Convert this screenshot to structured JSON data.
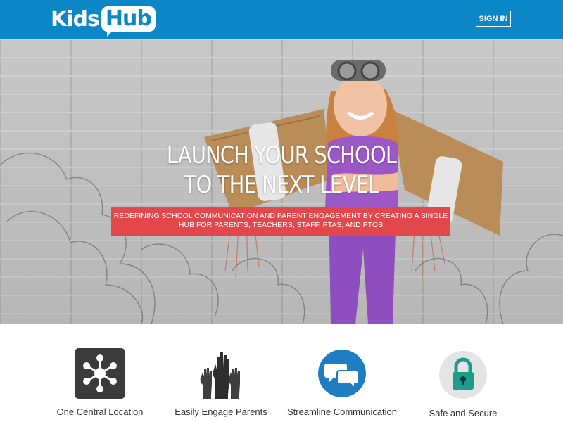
{
  "header": {
    "logo_part1": "Kids",
    "logo_part2": "Hub",
    "signin_label": "SIGN IN"
  },
  "hero": {
    "headline_line1": "LAUNCH YOUR SCHOOL",
    "headline_line2": "TO THE NEXT LEVEL",
    "subheadline": "REDEFINING SCHOOL COMMUNICATION AND PARENT ENGAGEMENT BY CREATING A SINGLE HUB FOR PARENTS, TEACHERS, STAFF, PTAS, AND PTOS"
  },
  "features": [
    {
      "label": "One Central Location",
      "icon": "network-hub-icon"
    },
    {
      "label": "Easily Engage Parents",
      "icon": "raised-hands-icon"
    },
    {
      "label": "Streamline Communication",
      "icon": "chat-bubbles-icon"
    },
    {
      "label": "Safe and Secure",
      "icon": "padlock-icon"
    }
  ],
  "colors": {
    "brand_blue": "#0b86c6",
    "banner_red": "#e2474b",
    "icon_dark": "#3b3b3b",
    "lock_teal": "#1f9b8a",
    "lock_bg": "#e4e4e4"
  }
}
